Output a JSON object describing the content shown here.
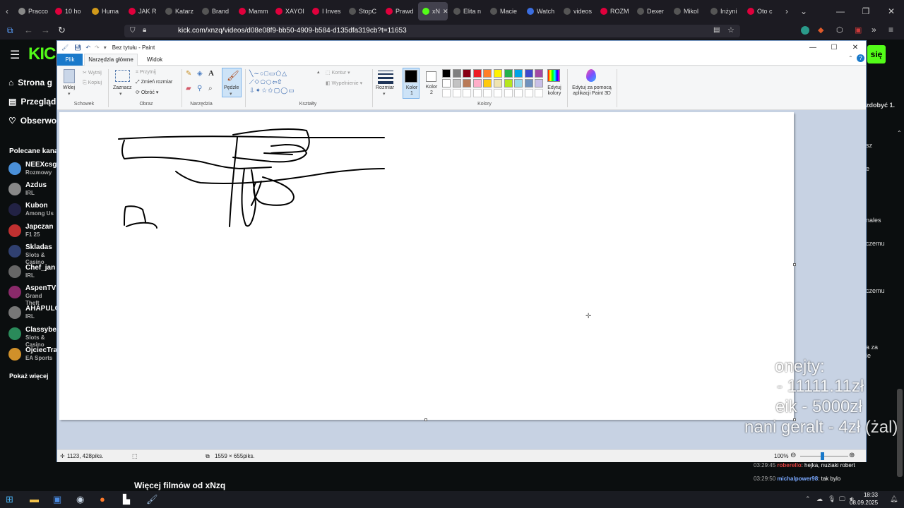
{
  "browser": {
    "tabs": [
      {
        "label": "Pracco",
        "color": "#888888"
      },
      {
        "label": "10 ho",
        "color": "#e0003c"
      },
      {
        "label": "Huma",
        "color": "#d19a1a"
      },
      {
        "label": "JAK R",
        "color": "#e0003c"
      },
      {
        "label": "Katarz",
        "color": "#555555"
      },
      {
        "label": "Brand",
        "color": "#555555"
      },
      {
        "label": "Mamm",
        "color": "#e0003c"
      },
      {
        "label": "XAYOI",
        "color": "#e0003c"
      },
      {
        "label": "I Inves",
        "color": "#e0003c"
      },
      {
        "label": "StopC",
        "color": "#555555"
      },
      {
        "label": "Prawd",
        "color": "#e0003c"
      },
      {
        "label": "xN",
        "color": "#53fc18"
      },
      {
        "label": "Elita n",
        "color": "#555555"
      },
      {
        "label": "Macie",
        "color": "#555555"
      },
      {
        "label": "Watch",
        "color": "#3b6ee0"
      },
      {
        "label": "videos",
        "color": "#555555"
      },
      {
        "label": "ROZM",
        "color": "#e0003c"
      },
      {
        "label": "Dexer",
        "color": "#555555"
      },
      {
        "label": "Mikol",
        "color": "#555555"
      },
      {
        "label": "Inżyni",
        "color": "#555555"
      },
      {
        "label": "Oto c",
        "color": "#e0003c"
      }
    ],
    "url": "kick.com/xnzq/videos/d08e08f9-bb50-4909-b584-d135dfa319cb?t=11653"
  },
  "kick": {
    "logo": "KICK",
    "nav": {
      "home": "Strona g",
      "browse": "Przegląd",
      "following": "Obserwo"
    },
    "recommended_title": "Polecane kana",
    "channels": [
      {
        "name": "NEEXcsgo",
        "category": "Rozmowy",
        "color": "#4a90d9"
      },
      {
        "name": "Azdus",
        "category": "IRL",
        "color": "#888888"
      },
      {
        "name": "Kubon",
        "category": "Among Us",
        "color": "#222244"
      },
      {
        "name": "Japczan",
        "category": "F1 25",
        "color": "#c03030"
      },
      {
        "name": "Skladas",
        "category": "Slots & Casino",
        "color": "#304070"
      },
      {
        "name": "Chef_jan",
        "category": "IRL",
        "color": "#666666"
      },
      {
        "name": "AspenTV",
        "category": "Grand Theft",
        "color": "#8a2a6a"
      },
      {
        "name": "AHAPULO",
        "category": "IRL",
        "color": "#777777"
      },
      {
        "name": "Classybet",
        "category": "Slots & Casino",
        "color": "#2a8a5a"
      },
      {
        "name": "OjciecTra",
        "category": "EA Sports",
        "color": "#d0902a"
      }
    ],
    "show_more": "Pokaż więcej",
    "login_btn": "się",
    "right_snippets": [
      "zdobyć 1.",
      "sz",
      "e",
      "nales",
      "czemu",
      "czemu",
      "a za",
      "ie"
    ],
    "donations": [
      "onejty:",
      "- 11111.11zł",
      "eik - 5000zł",
      "nani geralt - 4zł (żal)"
    ],
    "chat": [
      {
        "time": "03:29:45",
        "user": "roberello",
        "msg": ": hejka, nuziaki robert",
        "user_color": "#e04040"
      },
      {
        "time": "03:29:50",
        "user": "michalpower98",
        "msg": ": tak bylo",
        "user_color": "#7aa8ff"
      }
    ],
    "more_videos": "Więcej filmów od xNzq"
  },
  "paint": {
    "title": "Bez tytułu - Paint",
    "tabs": {
      "file": "Plik",
      "home": "Narzędzia główne",
      "view": "Widok"
    },
    "clipboard": {
      "paste": "Wklej",
      "cut": "Wytnij",
      "copy": "Kopiuj",
      "label": "Schowek"
    },
    "image": {
      "select": "Zaznacz",
      "crop": "Przytnij",
      "resize": "Zmień rozmiar",
      "rotate": "Obróć",
      "label": "Obraz"
    },
    "tools_label": "Narzędzia",
    "brushes": "Pędzle",
    "shapes": {
      "outline": "Kontur",
      "fill": "Wypełnienie",
      "label": "Kształty"
    },
    "size": "Rozmiar",
    "color1": "Kolor 1",
    "color2": "Kolor 2",
    "edit_colors": "Edytuj kolory",
    "paint3d": "Edytuj za pomocą aplikacji Paint 3D",
    "colors_label": "Kolory",
    "palette": [
      "#000000",
      "#7f7f7f",
      "#880015",
      "#ed1c24",
      "#ff7f27",
      "#fff200",
      "#22b14c",
      "#00a2e8",
      "#3f48cc",
      "#a349a4",
      "#ffffff",
      "#c3c3c3",
      "#b97a57",
      "#ffaec9",
      "#ffc90e",
      "#efe4b0",
      "#b5e61d",
      "#99d9ea",
      "#7092be",
      "#c8bfe7"
    ],
    "status": {
      "cursor": "1123, 428piks.",
      "size": "1559 × 655piks.",
      "zoom": "100%"
    }
  },
  "taskbar": {
    "time": "18:33",
    "date": "08.09.2025"
  }
}
